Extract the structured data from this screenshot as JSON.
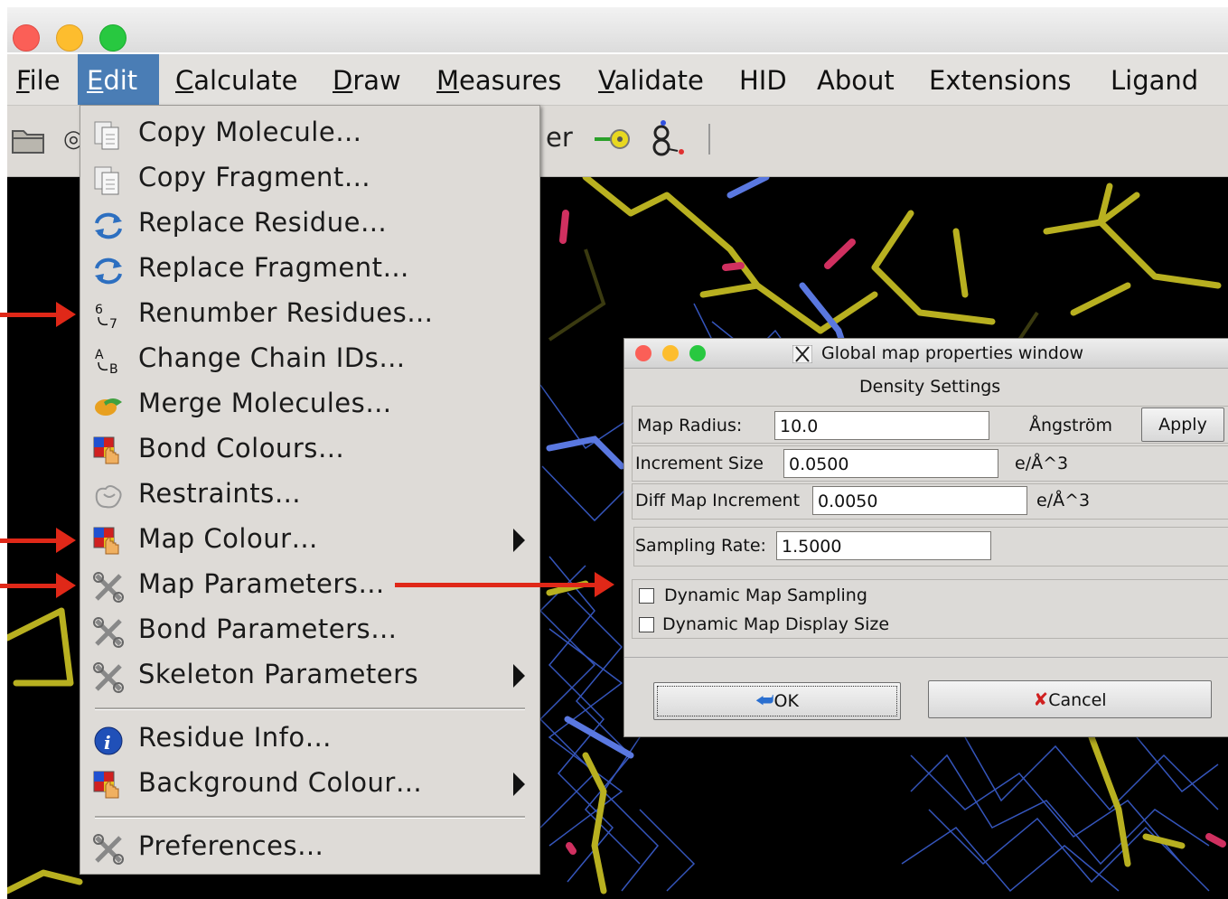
{
  "menubar": {
    "items": [
      {
        "name": "file",
        "prefix": "",
        "underline": "F",
        "rest": "ile"
      },
      {
        "name": "edit",
        "prefix": "",
        "underline": "E",
        "rest": "dit"
      },
      {
        "name": "calculate",
        "prefix": "",
        "underline": "C",
        "rest": "alculate"
      },
      {
        "name": "draw",
        "prefix": "",
        "underline": "D",
        "rest": "raw"
      },
      {
        "name": "measures",
        "prefix": "",
        "underline": "M",
        "rest": "easures"
      },
      {
        "name": "validate",
        "prefix": "",
        "underline": "V",
        "rest": "alidate"
      },
      {
        "name": "hid",
        "prefix": "HID",
        "underline": "",
        "rest": ""
      },
      {
        "name": "about",
        "prefix": "About",
        "underline": "",
        "rest": ""
      },
      {
        "name": "extensions",
        "prefix": "Extensions",
        "underline": "",
        "rest": ""
      },
      {
        "name": "ligand",
        "prefix": "Ligand",
        "underline": "",
        "rest": ""
      }
    ]
  },
  "toolbar": {
    "partial_label": "er"
  },
  "edit_menu": {
    "items": [
      {
        "label": "Copy Molecule…",
        "icon": "copy-icon"
      },
      {
        "label": "Copy Fragment…",
        "icon": "copy-icon"
      },
      {
        "label": "Replace Residue…",
        "icon": "replace-icon"
      },
      {
        "label": "Replace Fragment…",
        "icon": "replace-icon"
      },
      {
        "label": "Renumber Residues…",
        "icon": "renumber-icon"
      },
      {
        "label": "Change Chain IDs…",
        "icon": "chain-ids-icon"
      },
      {
        "label": "Merge Molecules…",
        "icon": "merge-icon"
      },
      {
        "label": "Bond Colours…",
        "icon": "palette-hand-icon"
      },
      {
        "label": "Restraints…",
        "icon": "restraints-icon"
      },
      {
        "label": "Map Colour…",
        "icon": "palette-hand-icon",
        "submenu": true
      },
      {
        "label": "Map Parameters…",
        "icon": "wrench-icon"
      },
      {
        "label": "Bond Parameters…",
        "icon": "wrench-icon"
      },
      {
        "label": "Skeleton Parameters",
        "icon": "wrench-icon",
        "submenu": true
      },
      {
        "label": "Residue Info…",
        "icon": "info-icon"
      },
      {
        "label": "Background Colour…",
        "icon": "palette-hand-icon",
        "submenu": true
      },
      {
        "label": "Preferences…",
        "icon": "wrench-icon"
      }
    ]
  },
  "dialog": {
    "title": "Global map properties window",
    "section_title": "Density Settings",
    "map_radius": {
      "label": "Map Radius:",
      "value": "10.0",
      "unit": "Ångström",
      "apply": "Apply"
    },
    "increment_size": {
      "label": "Increment Size",
      "value": "0.0500",
      "unit": "e/Å^3"
    },
    "diff_map_increment": {
      "label": "Diff Map Increment",
      "value": "0.0050",
      "unit": "e/Å^3"
    },
    "sampling_rate": {
      "label": "Sampling Rate:",
      "value": "1.5000"
    },
    "dynamic_map_sampling": {
      "label": "Dynamic Map Sampling",
      "checked": false
    },
    "dynamic_map_display_size": {
      "label": "Dynamic Map Display Size",
      "checked": false
    },
    "ok": "OK",
    "cancel": "Cancel"
  },
  "colors": {
    "menu_highlight": "#4a7db5",
    "annotation_arrow": "#e02818",
    "map_mesh": "#3b5fd0",
    "carbon_bond": "#b8b020"
  }
}
